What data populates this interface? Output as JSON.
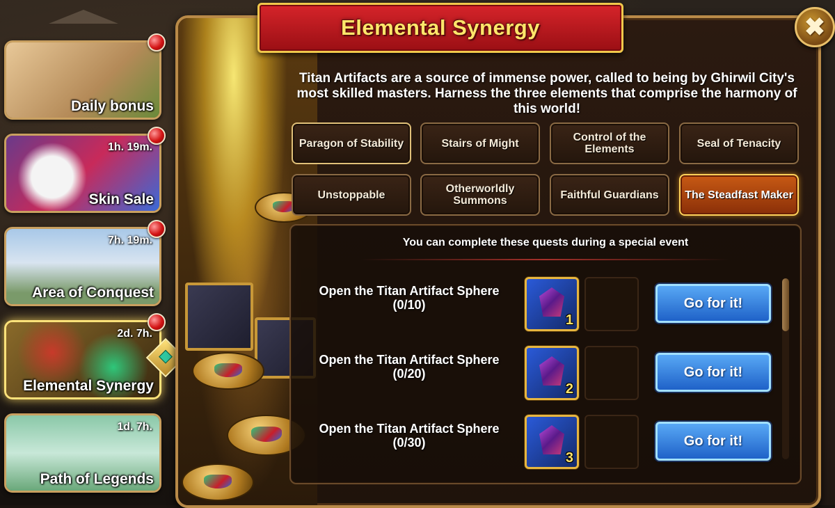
{
  "window": {
    "title": "Elemental Synergy",
    "close_glyph": "✖"
  },
  "description": "Titan Artifacts are a source of immense power, called to being by Ghirwil City's most skilled masters. Harness the three elements that comprise the harmony of this world!",
  "sidebar": {
    "items": [
      {
        "label": "Daily bonus",
        "timer": "",
        "badge": true
      },
      {
        "label": "Skin Sale",
        "timer": "1h. 19m.",
        "badge": true
      },
      {
        "label": "Area of Conquest",
        "timer": "7h. 19m.",
        "badge": true
      },
      {
        "label": "Elemental Synergy",
        "timer": "2d. 7h.",
        "badge": true,
        "active": true
      },
      {
        "label": "Path of Legends",
        "timer": "1d. 7h.",
        "badge": false
      }
    ]
  },
  "tabs": [
    {
      "label": "Paragon of Stability"
    },
    {
      "label": "Stairs of Might"
    },
    {
      "label": "Control of the Elements"
    },
    {
      "label": "Seal of Tenacity"
    },
    {
      "label": "Unstoppable"
    },
    {
      "label": "Otherworldly Summons"
    },
    {
      "label": "Faithful Guardians"
    },
    {
      "label": "The Steadfast Maker",
      "active": true
    }
  ],
  "quests": {
    "header": "You can complete these quests during a special event",
    "items": [
      {
        "title": "Open the Titan Artifact Sphere",
        "progress": "(0/10)",
        "reward_count": "1",
        "button": "Go for it!"
      },
      {
        "title": "Open the Titan Artifact Sphere",
        "progress": "(0/20)",
        "reward_count": "2",
        "button": "Go for it!"
      },
      {
        "title": "Open the Titan Artifact Sphere",
        "progress": "(0/30)",
        "reward_count": "3",
        "button": "Go for it!"
      }
    ]
  },
  "colors": {
    "ribbon": "#c81c22",
    "title_text": "#ffe66a",
    "active_tab": "#c85a14",
    "go_button": "#2f7fe0",
    "badge": "#d31414"
  }
}
